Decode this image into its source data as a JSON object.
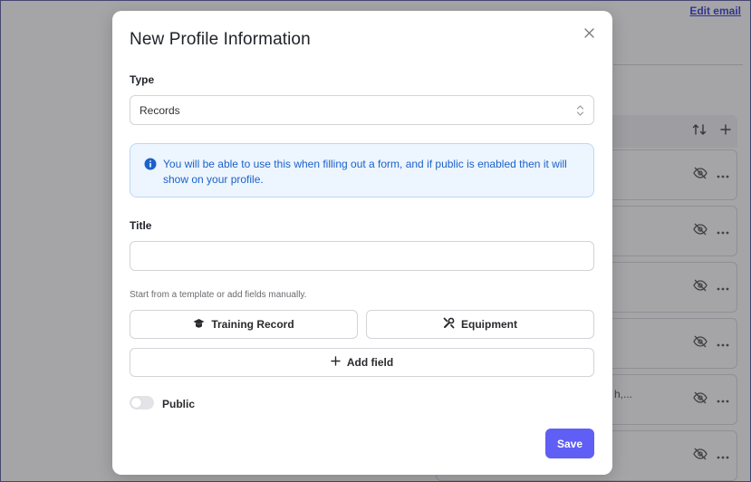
{
  "background": {
    "edit_email_label": "Edit email",
    "partial_row_text": "h,..."
  },
  "modal": {
    "title": "New Profile Information",
    "type_label": "Type",
    "type_selected": "Records",
    "info_text": "You will be able to use this when filling out a form, and if public is enabled then it will show on your profile.",
    "title_label": "Title",
    "title_value": "",
    "template_hint": "Start from a template or add fields manually.",
    "template_buttons": {
      "training_record": "Training Record",
      "equipment": "Equipment"
    },
    "add_field_label": "Add field",
    "public_label": "Public",
    "public_enabled": false,
    "save_label": "Save"
  },
  "colors": {
    "accent": "#5f5ef5",
    "info_text": "#1b62c9",
    "info_bg": "#edf5ff",
    "link": "#3b3bd6"
  }
}
